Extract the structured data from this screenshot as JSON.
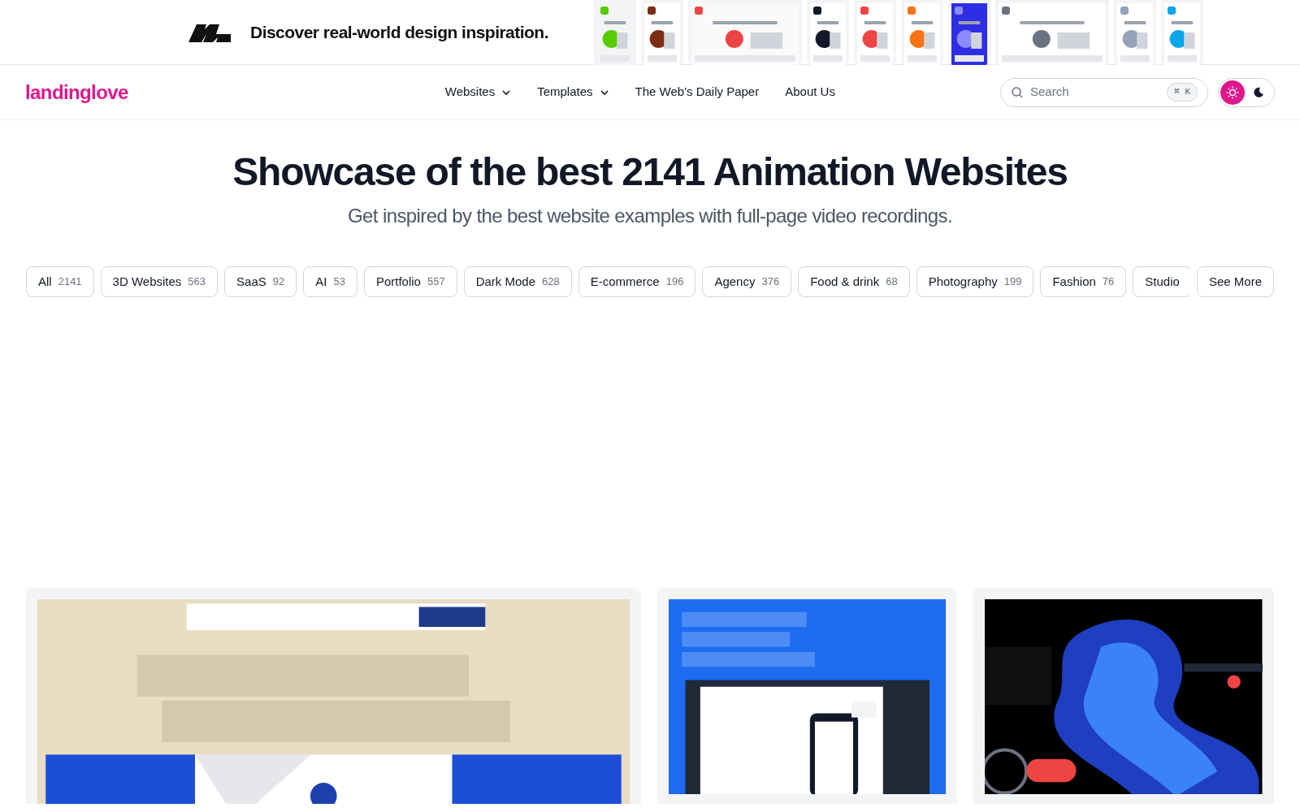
{
  "banner": {
    "text": "Discover real-world design inspiration."
  },
  "nav": {
    "logo": "landinglove",
    "links": [
      {
        "label": "Websites",
        "dropdown": true
      },
      {
        "label": "Templates",
        "dropdown": true
      },
      {
        "label": "The Web's Daily Paper",
        "dropdown": false
      },
      {
        "label": "About Us",
        "dropdown": false
      }
    ],
    "search": {
      "placeholder": "Search",
      "shortcut": "⌘ K"
    },
    "theme": {
      "light_selected": true
    }
  },
  "hero": {
    "title": "Showcase of the best 2141 Animation Websites",
    "subtitle": "Get inspired by the best website examples with full-page video recordings."
  },
  "filters": [
    {
      "label": "All",
      "count": "2141"
    },
    {
      "label": "3D Websites",
      "count": "563"
    },
    {
      "label": "SaaS",
      "count": "92"
    },
    {
      "label": "AI",
      "count": "53"
    },
    {
      "label": "Portfolio",
      "count": "557"
    },
    {
      "label": "Dark Mode",
      "count": "628"
    },
    {
      "label": "E-commerce",
      "count": "196"
    },
    {
      "label": "Agency",
      "count": "376"
    },
    {
      "label": "Food & drink",
      "count": "68"
    },
    {
      "label": "Photography",
      "count": "199"
    },
    {
      "label": "Fashion",
      "count": "76"
    },
    {
      "label": "Studio"
    }
  ],
  "see_more": "See More"
}
